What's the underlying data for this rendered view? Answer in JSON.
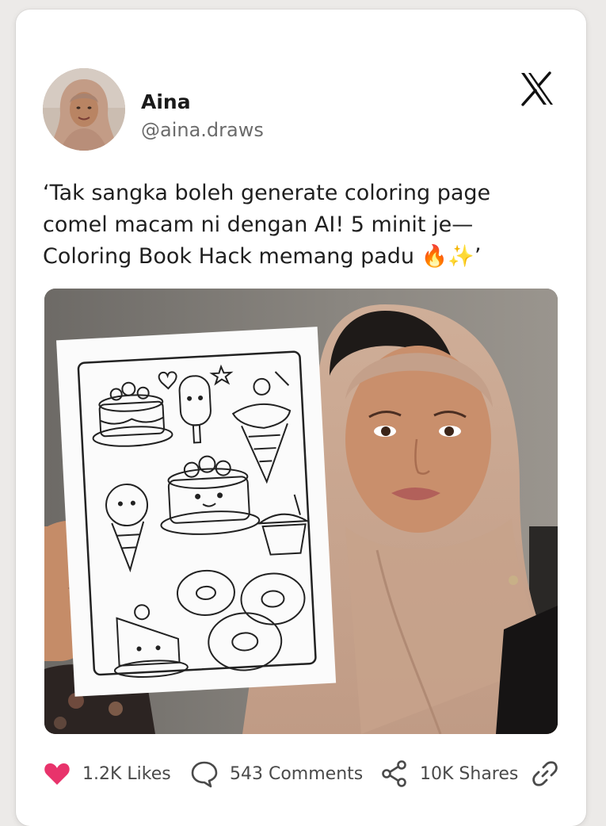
{
  "post": {
    "author": {
      "name": "Aina",
      "handle": "@aina.draws"
    },
    "platform_icon": "x-logo-icon",
    "text_lines": [
      "‘Tak sangka boleh generate coloring page",
      "comel macam ni dengan AI! 5 minit je—",
      "Coloring Book Hack memang padu 🔥✨’"
    ],
    "image": {
      "subject": "photo-of-woman-holding-coloring-page",
      "doodles": [
        "cake-icon",
        "popsicle-icon",
        "ice-cream-cone-icon",
        "ice-cream-cone-icon",
        "cake-icon",
        "cupcake-icon",
        "cake-slice-icon",
        "donut-icon",
        "donut-icon",
        "donut-icon",
        "heart-icon",
        "star-icon"
      ]
    }
  },
  "actions": {
    "likes": {
      "label": "1.2K Likes",
      "icon": "heart-icon",
      "color": "#e8336b"
    },
    "comments": {
      "label": "543 Comments",
      "icon": "comment-bubble-icon"
    },
    "shares": {
      "label": "10K Shares",
      "icon": "share-icon"
    },
    "link": {
      "icon": "link-icon"
    }
  },
  "colors": {
    "card_bg": "#ffffff",
    "page_bg": "#eceae8",
    "text_primary": "#1f1f1f",
    "text_secondary": "#6b6b6b",
    "heart": "#e8336b"
  }
}
